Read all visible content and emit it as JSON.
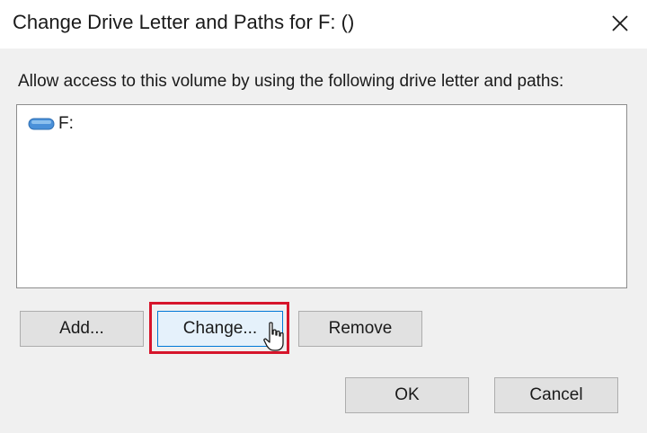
{
  "window": {
    "title": "Change Drive Letter and Paths for F: ()"
  },
  "dialog": {
    "instruction": "Allow access to this volume by using the following drive letter and paths:",
    "list_items": [
      {
        "icon": "drive-icon",
        "label": "F:"
      }
    ],
    "buttons": {
      "add": "Add...",
      "change": "Change...",
      "remove": "Remove",
      "ok": "OK",
      "cancel": "Cancel"
    }
  },
  "colors": {
    "highlight": "#d6152b",
    "focus_border": "#0078d7",
    "drive_icon": "#4a90d9"
  }
}
